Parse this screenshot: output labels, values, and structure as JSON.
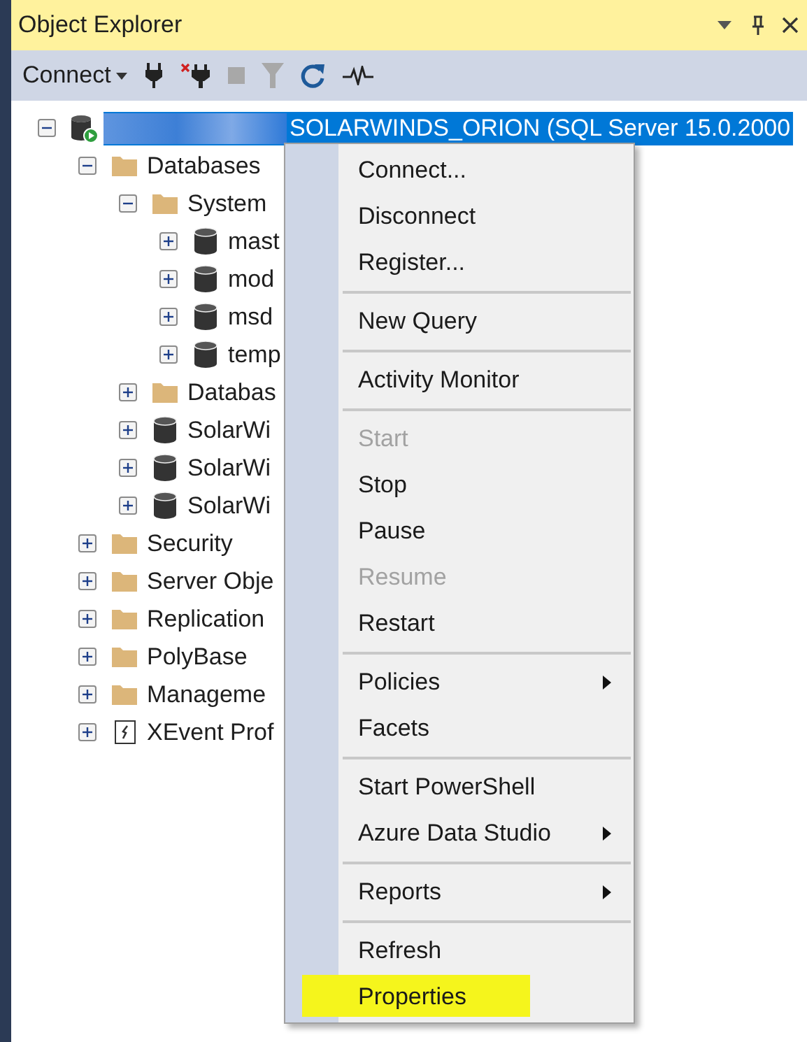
{
  "window": {
    "title": "Object Explorer"
  },
  "toolbar": {
    "connect_label": "Connect"
  },
  "tree": [
    {
      "kind": "server",
      "label": "SOLARWINDS_ORION (SQL Server 15.0.2000",
      "name_redacted": true,
      "selected": true,
      "expanded": true,
      "children": [
        {
          "kind": "folder",
          "label": "Databases",
          "selected": false,
          "expanded": true,
          "children": [
            {
              "kind": "folder",
              "label": "System",
              "selected": false,
              "expanded": true,
              "children": [
                {
                  "kind": "database",
                  "label": "mast",
                  "selected": false,
                  "expanded": false
                },
                {
                  "kind": "database",
                  "label": "mod",
                  "selected": false,
                  "expanded": false
                },
                {
                  "kind": "database",
                  "label": "msd",
                  "selected": false,
                  "expanded": false
                },
                {
                  "kind": "database",
                  "label": "temp",
                  "selected": false,
                  "expanded": false
                }
              ]
            },
            {
              "kind": "folder",
              "label": "Databas",
              "selected": false,
              "expanded": false
            },
            {
              "kind": "database",
              "label": "SolarWi",
              "selected": false,
              "expanded": false
            },
            {
              "kind": "database",
              "label": "SolarWi",
              "selected": false,
              "expanded": false
            },
            {
              "kind": "database",
              "label": "SolarWi",
              "selected": false,
              "expanded": false
            }
          ]
        },
        {
          "kind": "folder",
          "label": "Security",
          "selected": false,
          "expanded": false
        },
        {
          "kind": "folder",
          "label": "Server Obje",
          "selected": false,
          "expanded": false
        },
        {
          "kind": "folder",
          "label": "Replication",
          "selected": false,
          "expanded": false
        },
        {
          "kind": "folder",
          "label": "PolyBase",
          "selected": false,
          "expanded": false
        },
        {
          "kind": "folder",
          "label": "Manageme",
          "selected": false,
          "expanded": false
        },
        {
          "kind": "xevent",
          "label": "XEvent Prof",
          "selected": false,
          "expanded": false
        }
      ]
    }
  ],
  "context_menu": [
    {
      "kind": "item",
      "label": "Connect...",
      "disabled": false,
      "submenu": false,
      "highlighted": false
    },
    {
      "kind": "item",
      "label": "Disconnect",
      "disabled": false,
      "submenu": false,
      "highlighted": false
    },
    {
      "kind": "item",
      "label": "Register...",
      "disabled": false,
      "submenu": false,
      "highlighted": false
    },
    {
      "kind": "separator"
    },
    {
      "kind": "item",
      "label": "New Query",
      "disabled": false,
      "submenu": false,
      "highlighted": false
    },
    {
      "kind": "separator"
    },
    {
      "kind": "item",
      "label": "Activity Monitor",
      "disabled": false,
      "submenu": false,
      "highlighted": false
    },
    {
      "kind": "separator"
    },
    {
      "kind": "item",
      "label": "Start",
      "disabled": true,
      "submenu": false,
      "highlighted": false
    },
    {
      "kind": "item",
      "label": "Stop",
      "disabled": false,
      "submenu": false,
      "highlighted": false
    },
    {
      "kind": "item",
      "label": "Pause",
      "disabled": false,
      "submenu": false,
      "highlighted": false
    },
    {
      "kind": "item",
      "label": "Resume",
      "disabled": true,
      "submenu": false,
      "highlighted": false
    },
    {
      "kind": "item",
      "label": "Restart",
      "disabled": false,
      "submenu": false,
      "highlighted": false
    },
    {
      "kind": "separator"
    },
    {
      "kind": "item",
      "label": "Policies",
      "disabled": false,
      "submenu": true,
      "highlighted": false
    },
    {
      "kind": "item",
      "label": "Facets",
      "disabled": false,
      "submenu": false,
      "highlighted": false
    },
    {
      "kind": "separator"
    },
    {
      "kind": "item",
      "label": "Start PowerShell",
      "disabled": false,
      "submenu": false,
      "highlighted": false
    },
    {
      "kind": "item",
      "label": "Azure Data Studio",
      "disabled": false,
      "submenu": true,
      "highlighted": false
    },
    {
      "kind": "separator"
    },
    {
      "kind": "item",
      "label": "Reports",
      "disabled": false,
      "submenu": true,
      "highlighted": false
    },
    {
      "kind": "separator"
    },
    {
      "kind": "item",
      "label": "Refresh",
      "disabled": false,
      "submenu": false,
      "highlighted": false
    },
    {
      "kind": "item",
      "label": "Properties",
      "disabled": false,
      "submenu": false,
      "highlighted": true
    }
  ]
}
